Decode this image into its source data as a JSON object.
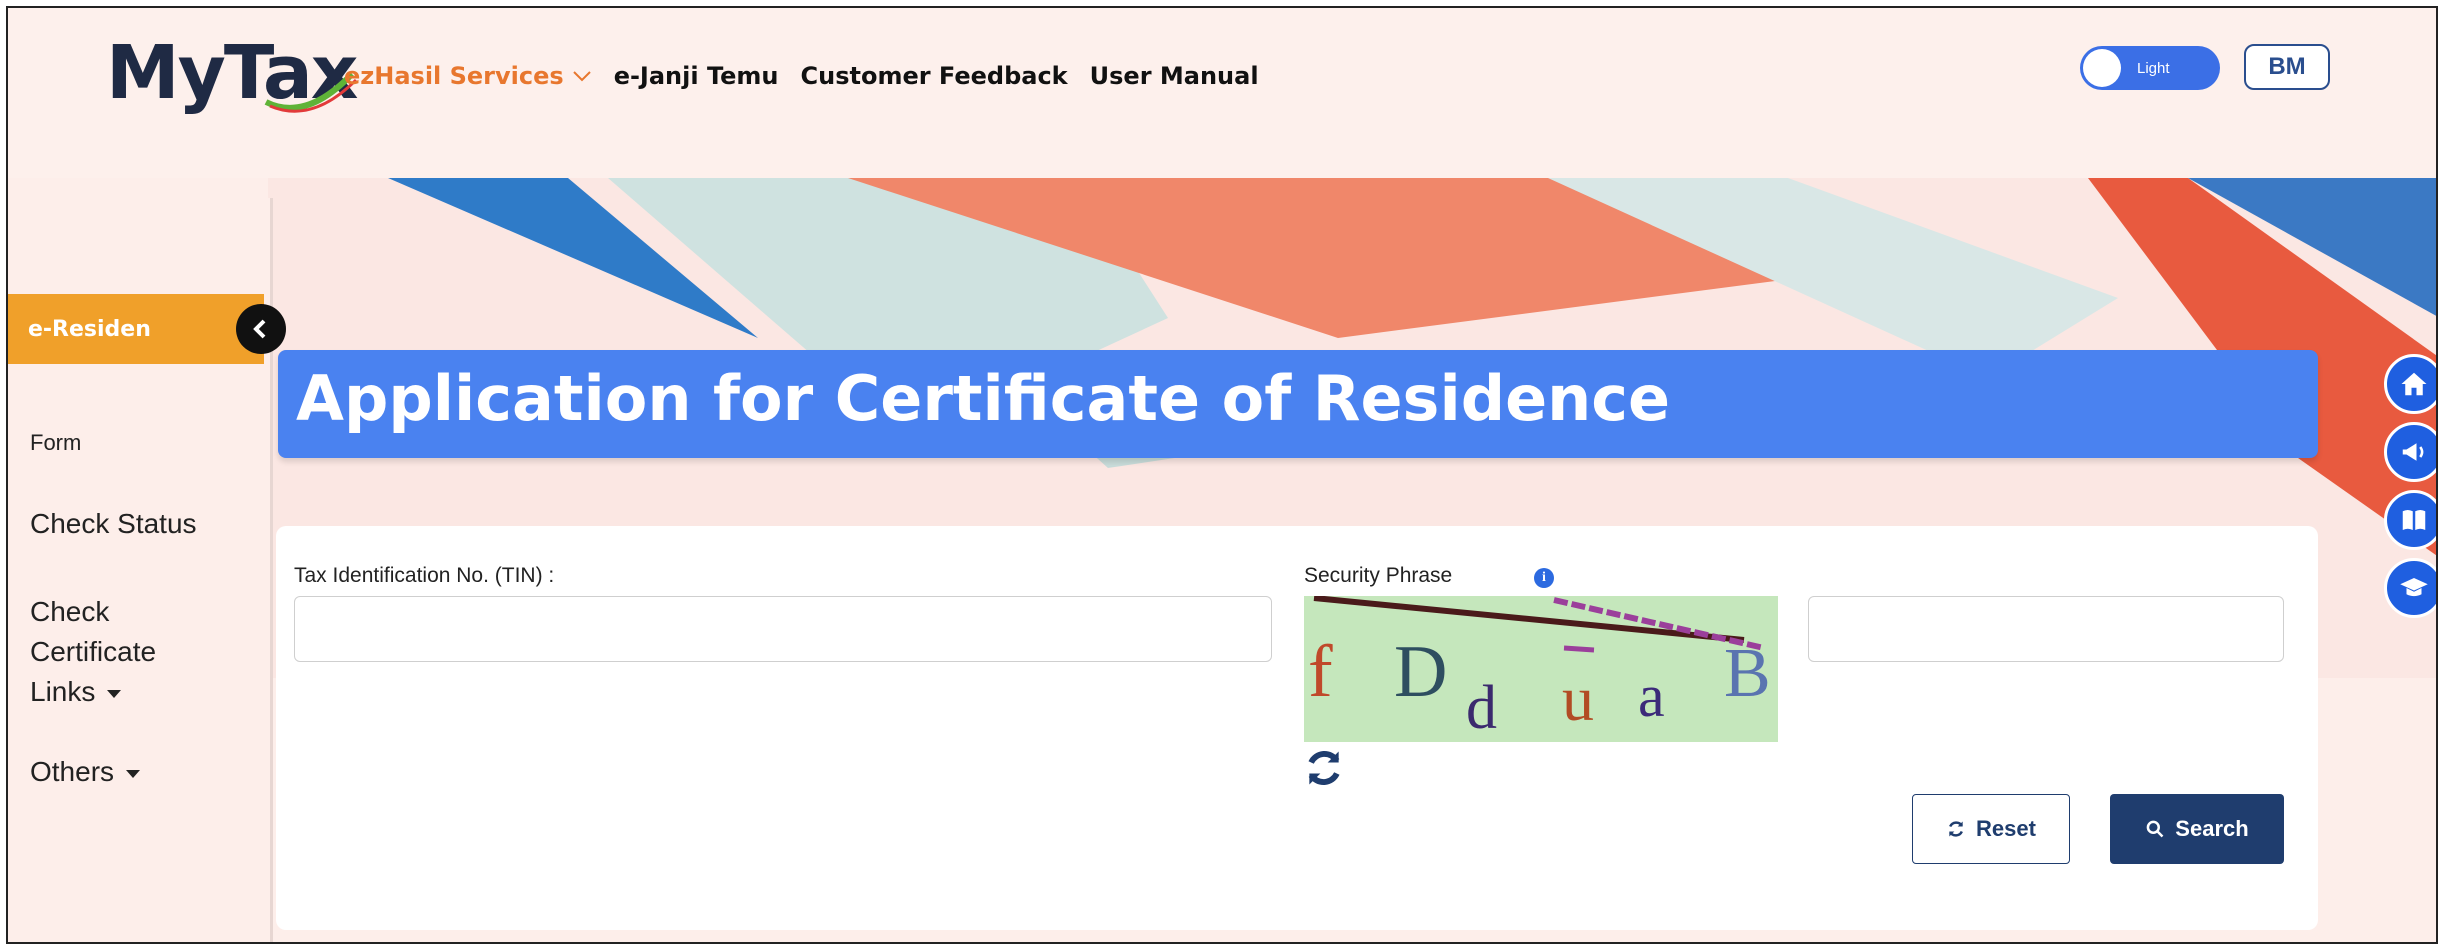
{
  "header": {
    "logo_text": "MyTax",
    "nav": [
      {
        "label": "ezHasil Services",
        "has_dropdown": true
      },
      {
        "label": "e-Janji Temu"
      },
      {
        "label": "Customer Feedback"
      },
      {
        "label": "User Manual"
      }
    ],
    "theme_toggle_label": "Light",
    "language_button": "BM"
  },
  "sidebar": {
    "active_item": "e-Residen",
    "items": [
      {
        "label": "Form"
      },
      {
        "label": "Check Status"
      },
      {
        "label": "Check Certificate Links",
        "line1": "Check",
        "line2": "Certificate",
        "line3": "Links",
        "has_dropdown": true
      },
      {
        "label": "Others",
        "has_dropdown": true
      }
    ]
  },
  "page": {
    "title": "Application for Certificate of Residence"
  },
  "form": {
    "tin_label": "Tax Identification No. (TIN) :",
    "tin_value": "",
    "security_label": "Security Phrase",
    "captcha_text": "fDduaB",
    "captcha_chars": [
      "f",
      "D",
      "d",
      "u",
      "a",
      "B"
    ],
    "security_value": "",
    "reset_label": "Reset",
    "search_label": "Search"
  },
  "floating_icons": [
    "home-icon",
    "megaphone-icon",
    "book-icon",
    "graduation-cap-icon"
  ],
  "colors": {
    "accent_blue": "#4a82f0",
    "nav_orange": "#e8772e",
    "sidebar_active": "#f0a02a",
    "button_navy": "#1f3d6e"
  }
}
